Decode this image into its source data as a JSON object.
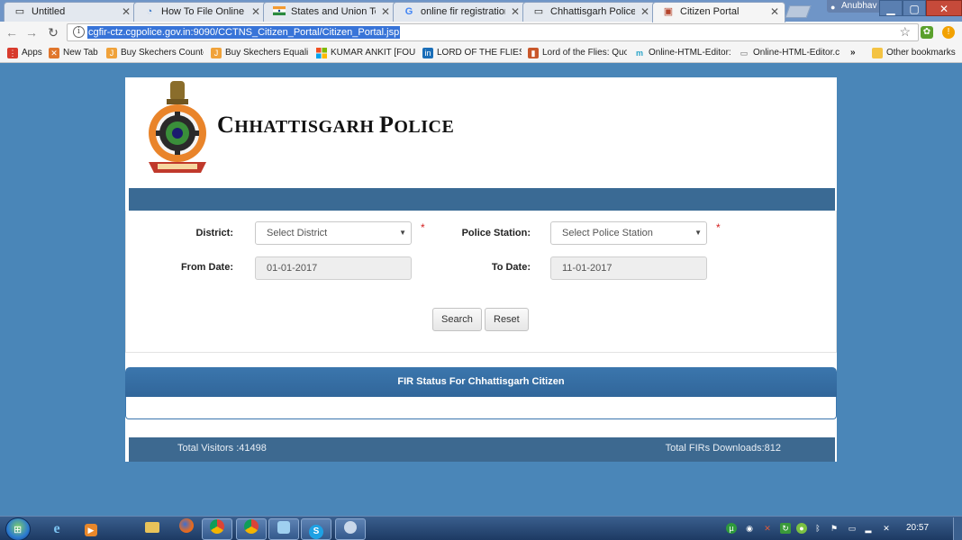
{
  "browser": {
    "tabs": [
      {
        "title": "Untitled",
        "icon": "page-icon"
      },
      {
        "title": "How To File Online FIR",
        "icon": "loading-icon"
      },
      {
        "title": "States and Union Territ",
        "icon": "india-flag-icon"
      },
      {
        "title": "online fir registration cl",
        "icon": "google-icon"
      },
      {
        "title": "Chhattisgarh Police",
        "icon": "page-icon"
      },
      {
        "title": "Citizen Portal",
        "icon": "portal-icon"
      }
    ],
    "active_tab_index": 5,
    "user_name": "Anubhav",
    "url": "cgfir-ctz.cgpolice.gov.in:9090/CCTNS_Citizen_Portal/Citizen_Portal.jsp",
    "bookmarks": [
      {
        "label": "Apps",
        "icon": "apps-grid-icon",
        "color": "#d83b2d"
      },
      {
        "label": "New Tab",
        "icon": "new-tab-icon",
        "color": "#e0762c"
      },
      {
        "label": "Buy Skechers Counter",
        "icon": "bookmark-j-icon",
        "color": "#f0a23a"
      },
      {
        "label": "Buy Skechers Equalize",
        "icon": "bookmark-j-icon",
        "color": "#f0a23a"
      },
      {
        "label": "KUMAR ANKIT [FOUN",
        "icon": "microsoft-icon",
        "color": "#1e88e5"
      },
      {
        "label": "LORD OF THE FLIES: A",
        "icon": "linkedin-icon",
        "color": "#1a6eb8"
      },
      {
        "label": "Lord of the Flies: Quot",
        "icon": "bar-chart-icon",
        "color": "#c9572a"
      },
      {
        "label": "Online-HTML-Editor:",
        "icon": "m-logo-icon",
        "color": "#2aa4c8"
      },
      {
        "label": "Online-HTML-Editor.c",
        "icon": "page-icon",
        "color": "#ffffff"
      }
    ],
    "overflow_label": "»",
    "other_bookmarks": "Other bookmarks"
  },
  "page": {
    "brand_first": "C",
    "brand_rest_1": "HHATTISGARH ",
    "brand_second": "P",
    "brand_rest_2": "OLICE",
    "emblem_icon": "chhattisgarh-police-emblem",
    "form": {
      "district_label": "District:",
      "district_value": "Select District",
      "station_label": "Police Station:",
      "station_value": "Select Police Station",
      "required_mark": "*",
      "from_label": "From Date:",
      "from_value": "01-01-2017",
      "to_label": "To Date:",
      "to_value": "11-01-2017",
      "search_label": "Search",
      "reset_label": "Reset"
    },
    "fir_heading": "FIR Status For Chhattisgarh Citizen",
    "footer": {
      "visitors": "Total Visitors :41498",
      "downloads": "Total FIRs Downloads:812"
    },
    "colors": {
      "page_bg": "#4a86b8",
      "header_bar": "#3a6a94",
      "fir_header": "#3b76ad",
      "footer_bar": "#3d6990",
      "required": "#d42020"
    }
  },
  "taskbar": {
    "apps": [
      {
        "name": "internet-explorer",
        "icon": "ie-icon"
      },
      {
        "name": "media-player",
        "icon": "media-player-icon"
      },
      {
        "name": "file-explorer",
        "icon": "folder-icon"
      },
      {
        "name": "firefox",
        "icon": "firefox-icon"
      },
      {
        "name": "chrome",
        "icon": "chrome-icon"
      },
      {
        "name": "chrome-secondary",
        "icon": "chrome-icon"
      },
      {
        "name": "paint",
        "icon": "paint-icon"
      },
      {
        "name": "skype",
        "icon": "skype-icon"
      },
      {
        "name": "other-app",
        "icon": "app-icon"
      }
    ],
    "clock": "20:57"
  }
}
